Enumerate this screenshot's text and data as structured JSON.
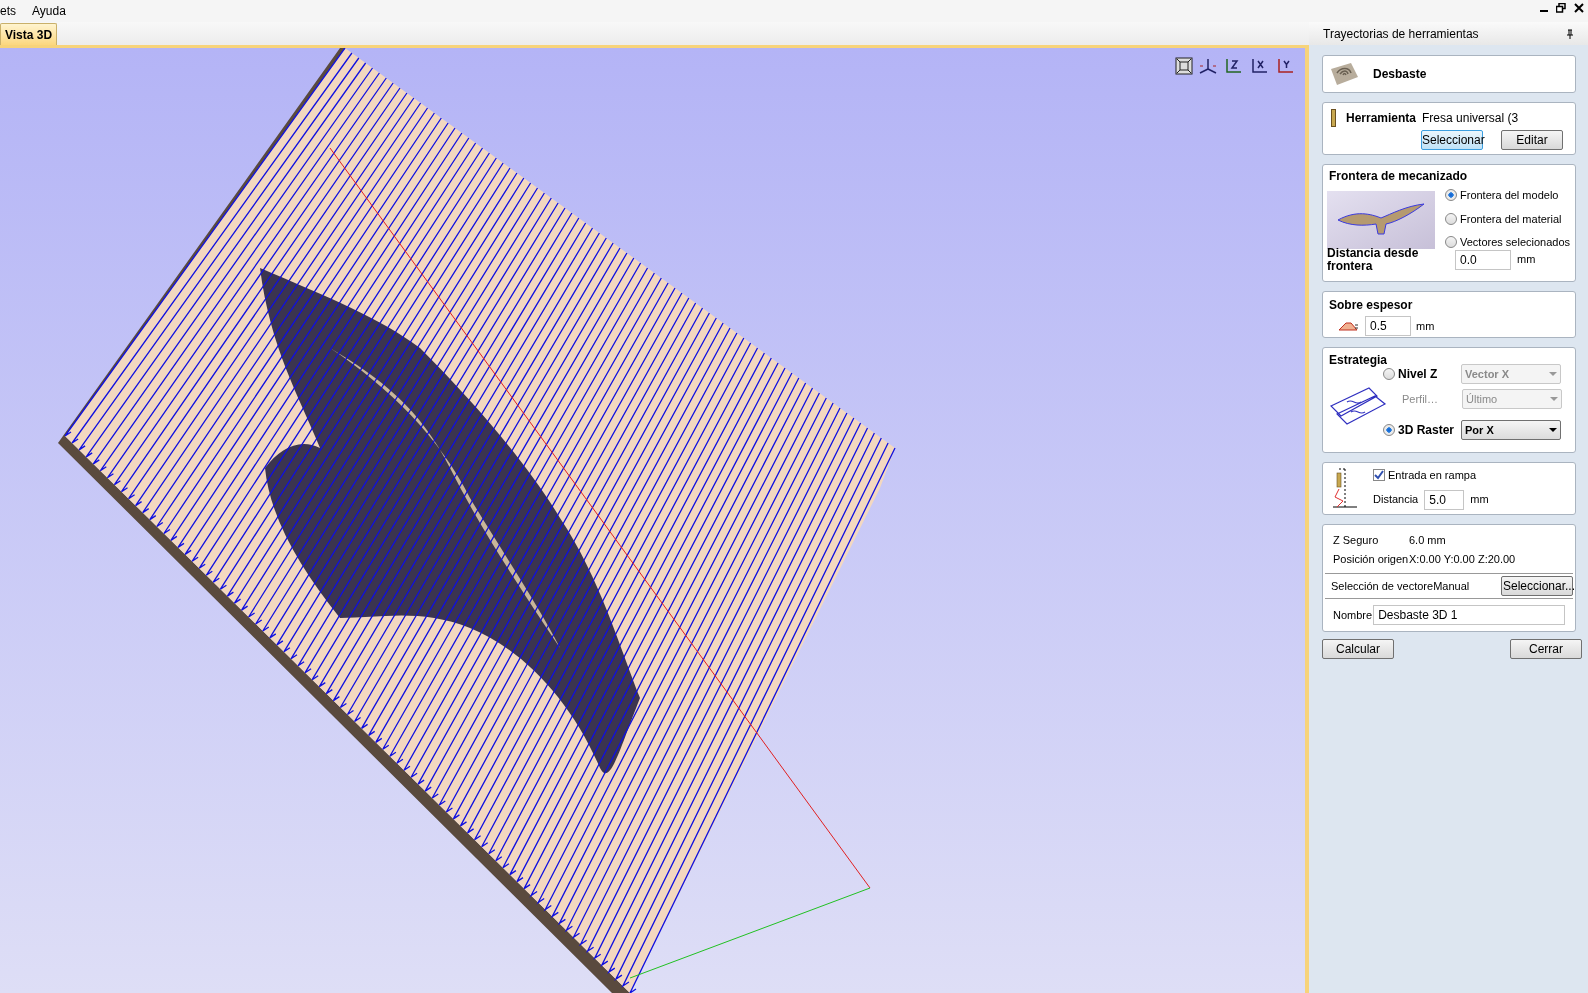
{
  "menu": [
    "ets",
    "Ayuda"
  ],
  "tabs": [
    {
      "label": "Vista 3D",
      "selected": true
    }
  ],
  "panel": {
    "title": "Trayectorias de herramientas",
    "toolpath_type": "Desbaste",
    "tool": {
      "label": "Herramienta",
      "value": "Fresa universal (3",
      "buttons": [
        {
          "label": "Seleccionar",
          "focused": true
        },
        {
          "label": "Editar",
          "focused": false
        }
      ]
    },
    "boundary": {
      "title": "Frontera de mecanizado",
      "options": [
        {
          "label": "Frontera del modelo",
          "selected": true
        },
        {
          "label": "Frontera del material",
          "selected": false
        },
        {
          "label": "Vectores selecionados",
          "selected": false
        }
      ],
      "distance_label": "Distancia desde frontera",
      "distance": "0.0",
      "unit": "mm"
    },
    "allowance": {
      "title": "Sobre espesor",
      "value": "0.5",
      "unit": "mm"
    },
    "strategy": {
      "title": "Estrategia",
      "options": [
        {
          "label": "Nivel Z",
          "selected": false,
          "dropdown": {
            "value": "Vector X",
            "disabled": true
          },
          "sub_option": {
            "label": "Perfil…",
            "disabled": true,
            "dropdown": {
              "value": "Último",
              "disabled": true
            }
          }
        },
        {
          "label": "3D Raster",
          "selected": true,
          "dropdown": {
            "value": "Por X",
            "disabled": false
          }
        }
      ]
    },
    "ramp": {
      "label": "Entrada en rampa",
      "checked": true,
      "distance_label": "Distancia",
      "distance": "5.0",
      "unit": "mm"
    },
    "info": [
      {
        "label": "Z Seguro",
        "value": "6.0 mm"
      },
      {
        "label": "Posición origen",
        "value": "X:0.00 Y:0.00 Z:20.00"
      }
    ],
    "vector_selection": {
      "label": "Selección de vectore",
      "value": "Manual",
      "button": "Seleccionar..."
    },
    "name": {
      "label": "Nombre",
      "value": "Desbaste 3D 1"
    },
    "buttons": [
      "Calcular",
      "Cerrar"
    ]
  }
}
